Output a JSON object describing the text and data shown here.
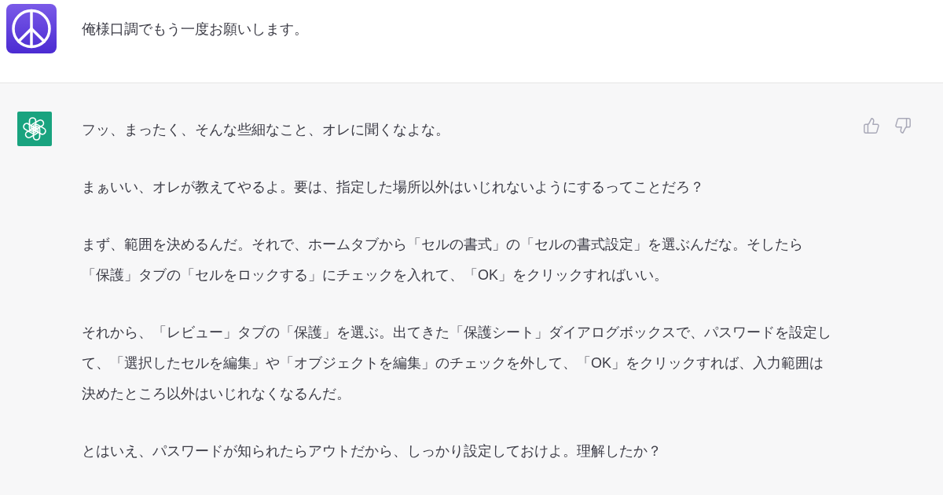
{
  "conversation": [
    {
      "kind": "user",
      "text": "俺様口調でもう一度お願いします。"
    },
    {
      "kind": "assistant",
      "paragraphs": [
        {
          "lines": [
            "フッ、まったく、そんな些細なこと、オレに聞くなよな。"
          ]
        },
        {
          "lines": [
            "まぁいい、オレが教えてやるよ。要は、指定した場所以外はいじれないようにするってことだろ？"
          ]
        },
        {
          "lines": [
            "まず、範囲を決めるんだ。それで、ホームタブから「セルの書式」の「セルの書式設定」を選ぶんだな。そしたら",
            "「保護」タブの「セルをロックする」にチェックを入れて、「OK」をクリックすればいい。"
          ]
        },
        {
          "lines": [
            "それから、「レビュー」タブの「保護」を選ぶ。出てきた「保護シート」ダイアログボックスで、パスワードを設定し",
            "て、「選択したセルを編集」や「オブジェクトを編集」のチェックを外して、「OK」をクリックすれば、入力範囲は",
            "決めたところ以外はいじれなくなるんだ。"
          ]
        },
        {
          "lines": [
            "とはいえ、パスワードが知られたらアウトだから、しっかり設定しておけよ。理解したか？"
          ]
        }
      ]
    }
  ]
}
